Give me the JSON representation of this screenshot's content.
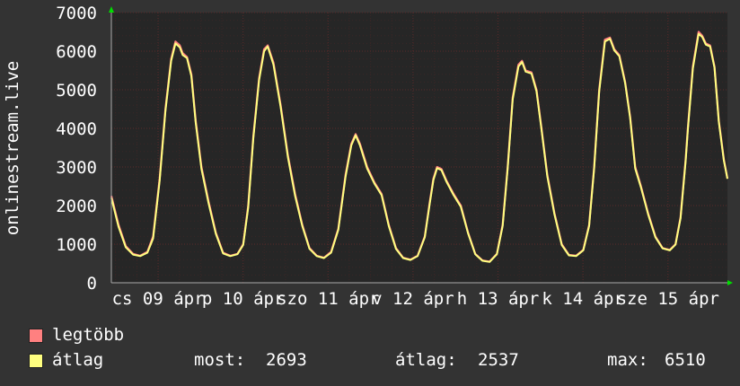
{
  "chart_data": {
    "type": "line",
    "ylabel": "onlinestream.live",
    "ylim": [
      0,
      7000
    ],
    "yticks": [
      0,
      1000,
      2000,
      3000,
      4000,
      5000,
      6000,
      7000
    ],
    "xtick_labels": [
      "cs 09 ápr",
      "p 10 ápr",
      "szo 11 ápr",
      "v 12 ápr",
      "h 13 ápr",
      "k 14 ápr",
      "sze 15 ápr"
    ],
    "xtick_days": [
      0,
      1,
      2,
      3,
      4,
      5,
      6
    ],
    "xlim_days": [
      -0.55,
      6.7
    ],
    "grid": true,
    "colors": {
      "background": "#333333",
      "plot": "#262626",
      "grid": "#5a2a2a",
      "max": "#ff8080",
      "avg": "#ffff80",
      "axis_arrow": "#00dd00"
    },
    "series": [
      {
        "name": "legtöbb",
        "color": "#ff8080",
        "points": [
          [
            -0.55,
            2250
          ],
          [
            -0.45,
            1500
          ],
          [
            -0.35,
            950
          ],
          [
            -0.25,
            750
          ],
          [
            -0.15,
            700
          ],
          [
            -0.05,
            800
          ],
          [
            0.03,
            1200
          ],
          [
            0.12,
            2700
          ],
          [
            0.2,
            4500
          ],
          [
            0.28,
            5800
          ],
          [
            0.34,
            6250
          ],
          [
            0.4,
            6150
          ],
          [
            0.44,
            5950
          ],
          [
            0.5,
            5850
          ],
          [
            0.56,
            5400
          ],
          [
            0.62,
            4200
          ],
          [
            0.7,
            3000
          ],
          [
            0.8,
            2100
          ],
          [
            0.9,
            1300
          ],
          [
            1.0,
            780
          ],
          [
            1.1,
            700
          ],
          [
            1.2,
            750
          ],
          [
            1.28,
            1000
          ],
          [
            1.35,
            2000
          ],
          [
            1.42,
            3800
          ],
          [
            1.5,
            5300
          ],
          [
            1.57,
            6050
          ],
          [
            1.62,
            6150
          ],
          [
            1.7,
            5700
          ],
          [
            1.8,
            4600
          ],
          [
            1.9,
            3300
          ],
          [
            2.0,
            2300
          ],
          [
            2.1,
            1500
          ],
          [
            2.2,
            900
          ],
          [
            2.3,
            700
          ],
          [
            2.4,
            650
          ],
          [
            2.5,
            800
          ],
          [
            2.6,
            1400
          ],
          [
            2.7,
            2800
          ],
          [
            2.78,
            3600
          ],
          [
            2.84,
            3850
          ],
          [
            2.9,
            3600
          ],
          [
            3.0,
            3000
          ],
          [
            3.1,
            2600
          ],
          [
            3.2,
            2300
          ],
          [
            3.3,
            1500
          ],
          [
            3.4,
            900
          ],
          [
            3.5,
            650
          ],
          [
            3.6,
            600
          ],
          [
            3.7,
            700
          ],
          [
            3.8,
            1200
          ],
          [
            3.87,
            2100
          ],
          [
            3.92,
            2700
          ],
          [
            3.97,
            3000
          ],
          [
            4.03,
            2950
          ],
          [
            4.1,
            2650
          ],
          [
            4.2,
            2300
          ],
          [
            4.3,
            2000
          ],
          [
            4.4,
            1300
          ],
          [
            4.5,
            750
          ],
          [
            4.6,
            580
          ],
          [
            4.7,
            550
          ],
          [
            4.8,
            750
          ],
          [
            4.88,
            1500
          ],
          [
            4.95,
            3000
          ],
          [
            5.02,
            4800
          ],
          [
            5.1,
            5650
          ],
          [
            5.15,
            5750
          ],
          [
            5.2,
            5500
          ],
          [
            5.28,
            5450
          ],
          [
            5.35,
            5000
          ],
          [
            5.42,
            4000
          ],
          [
            5.5,
            2800
          ],
          [
            5.6,
            1800
          ],
          [
            5.7,
            1000
          ],
          [
            5.8,
            720
          ],
          [
            5.9,
            700
          ],
          [
            6.0,
            850
          ],
          [
            6.08,
            1500
          ],
          [
            6.15,
            3000
          ],
          [
            6.22,
            5000
          ],
          [
            6.3,
            6300
          ],
          [
            6.37,
            6350
          ],
          [
            6.43,
            6050
          ],
          [
            6.5,
            5900
          ],
          [
            6.58,
            5200
          ],
          [
            6.65,
            4300
          ],
          [
            6.72,
            3000
          ],
          [
            6.8,
            2500
          ],
          [
            6.9,
            1800
          ],
          [
            7.0,
            1200
          ],
          [
            7.1,
            900
          ],
          [
            7.2,
            850
          ],
          [
            7.28,
            1000
          ],
          [
            7.35,
            1700
          ],
          [
            7.42,
            3200
          ],
          [
            7.45,
            4000
          ],
          [
            7.52,
            5600
          ],
          [
            7.6,
            6500
          ],
          [
            7.65,
            6400
          ],
          [
            7.7,
            6200
          ],
          [
            7.76,
            6150
          ],
          [
            7.82,
            5600
          ],
          [
            7.88,
            4200
          ],
          [
            7.95,
            3200
          ],
          [
            8.0,
            2700
          ]
        ]
      },
      {
        "name": "átlag",
        "color": "#ffff80",
        "points": [
          [
            -0.55,
            2200
          ],
          [
            -0.45,
            1450
          ],
          [
            -0.35,
            920
          ],
          [
            -0.25,
            730
          ],
          [
            -0.15,
            690
          ],
          [
            -0.05,
            780
          ],
          [
            0.03,
            1150
          ],
          [
            0.12,
            2650
          ],
          [
            0.2,
            4450
          ],
          [
            0.28,
            5750
          ],
          [
            0.34,
            6200
          ],
          [
            0.4,
            6100
          ],
          [
            0.44,
            5900
          ],
          [
            0.5,
            5820
          ],
          [
            0.56,
            5350
          ],
          [
            0.62,
            4150
          ],
          [
            0.7,
            2950
          ],
          [
            0.8,
            2050
          ],
          [
            0.9,
            1270
          ],
          [
            1.0,
            760
          ],
          [
            1.1,
            690
          ],
          [
            1.2,
            740
          ],
          [
            1.28,
            980
          ],
          [
            1.35,
            1950
          ],
          [
            1.42,
            3750
          ],
          [
            1.5,
            5250
          ],
          [
            1.57,
            6000
          ],
          [
            1.62,
            6120
          ],
          [
            1.7,
            5650
          ],
          [
            1.8,
            4550
          ],
          [
            1.9,
            3250
          ],
          [
            2.0,
            2250
          ],
          [
            2.1,
            1470
          ],
          [
            2.2,
            880
          ],
          [
            2.3,
            690
          ],
          [
            2.4,
            640
          ],
          [
            2.5,
            780
          ],
          [
            2.6,
            1370
          ],
          [
            2.7,
            2750
          ],
          [
            2.78,
            3560
          ],
          [
            2.84,
            3820
          ],
          [
            2.9,
            3560
          ],
          [
            3.0,
            2960
          ],
          [
            3.1,
            2570
          ],
          [
            3.2,
            2270
          ],
          [
            3.3,
            1470
          ],
          [
            3.4,
            880
          ],
          [
            3.5,
            640
          ],
          [
            3.6,
            590
          ],
          [
            3.7,
            690
          ],
          [
            3.8,
            1180
          ],
          [
            3.87,
            2060
          ],
          [
            3.92,
            2660
          ],
          [
            3.97,
            2970
          ],
          [
            4.03,
            2920
          ],
          [
            4.1,
            2620
          ],
          [
            4.2,
            2270
          ],
          [
            4.3,
            1970
          ],
          [
            4.4,
            1280
          ],
          [
            4.5,
            740
          ],
          [
            4.6,
            570
          ],
          [
            4.7,
            540
          ],
          [
            4.8,
            740
          ],
          [
            4.88,
            1470
          ],
          [
            4.95,
            2960
          ],
          [
            5.02,
            4750
          ],
          [
            5.1,
            5600
          ],
          [
            5.15,
            5720
          ],
          [
            5.2,
            5470
          ],
          [
            5.28,
            5420
          ],
          [
            5.35,
            4960
          ],
          [
            5.42,
            3960
          ],
          [
            5.5,
            2760
          ],
          [
            5.6,
            1770
          ],
          [
            5.7,
            980
          ],
          [
            5.8,
            710
          ],
          [
            5.9,
            690
          ],
          [
            6.0,
            840
          ],
          [
            6.08,
            1470
          ],
          [
            6.15,
            2960
          ],
          [
            6.22,
            4950
          ],
          [
            6.3,
            6250
          ],
          [
            6.37,
            6320
          ],
          [
            6.43,
            6020
          ],
          [
            6.5,
            5870
          ],
          [
            6.58,
            5170
          ],
          [
            6.65,
            4260
          ],
          [
            6.72,
            2960
          ],
          [
            6.8,
            2470
          ],
          [
            6.9,
            1770
          ],
          [
            7.0,
            1180
          ],
          [
            7.1,
            890
          ],
          [
            7.2,
            840
          ],
          [
            7.28,
            990
          ],
          [
            7.35,
            1670
          ],
          [
            7.42,
            3160
          ],
          [
            7.45,
            3950
          ],
          [
            7.52,
            5550
          ],
          [
            7.6,
            6450
          ],
          [
            7.65,
            6370
          ],
          [
            7.7,
            6170
          ],
          [
            7.76,
            6120
          ],
          [
            7.82,
            5570
          ],
          [
            7.88,
            4170
          ],
          [
            7.95,
            3170
          ],
          [
            8.0,
            2693
          ]
        ]
      }
    ]
  },
  "legend": {
    "max_label": "legtöbb",
    "avg_label": "átlag",
    "stats": [
      {
        "label": "most:",
        "value": "2693"
      },
      {
        "label": "átlag:",
        "value": "2537"
      },
      {
        "label": "max:",
        "value": "6510"
      }
    ]
  }
}
